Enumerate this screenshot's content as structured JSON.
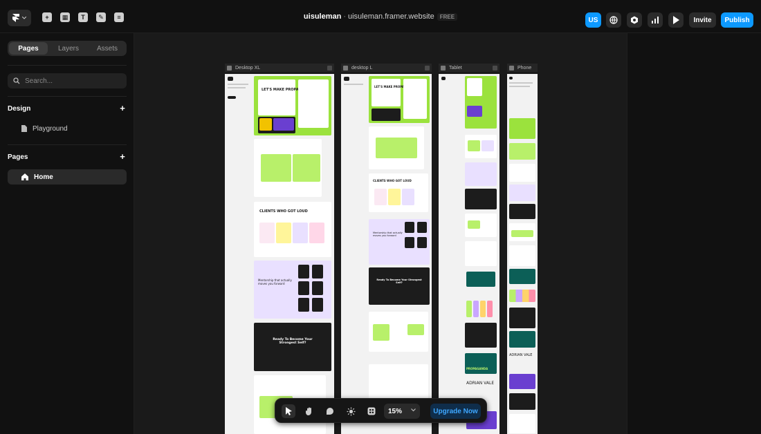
{
  "topbar": {
    "project_name": "uisuleman",
    "separator": "·",
    "domain": "uisuleman.framer.website",
    "plan_badge": "FREE",
    "user_initials": "US",
    "invite_label": "Invite",
    "publish_label": "Publish",
    "tool_icons": [
      "insert-icon",
      "layout-icon",
      "text-icon",
      "vector-icon",
      "cms-icon"
    ],
    "right_icons": [
      "globe-icon",
      "settings-icon",
      "analytics-icon",
      "preview-play-icon"
    ],
    "accent": "#0d99ff"
  },
  "sidebar": {
    "tabs": [
      {
        "label": "Pages",
        "active": true
      },
      {
        "label": "Layers",
        "active": false
      },
      {
        "label": "Assets",
        "active": false
      }
    ],
    "search_placeholder": "Search...",
    "design_section": {
      "title": "Design",
      "items": [
        {
          "label": "Playground",
          "icon": "file-icon"
        }
      ]
    },
    "pages_section": {
      "title": "Pages",
      "items": [
        {
          "label": "Home",
          "icon": "home-icon",
          "selected": true
        }
      ]
    }
  },
  "canvas": {
    "breakpoints": [
      {
        "label": "Desktop XL"
      },
      {
        "label": "desktop L"
      },
      {
        "label": "Tablet"
      },
      {
        "label": "Phone"
      }
    ],
    "preview_texts": {
      "hero": "LET'S MAKE PROPAGANDA",
      "clients": "CLIENTS WHO GOT LOUD",
      "mentorship": "Mentorship that actually moves you forward",
      "ready": "Ready To Become Your Strongest Self?",
      "name": "ADRIAN VALE",
      "brand": "PROPAGANDA"
    }
  },
  "bottom_toolbar": {
    "tools": [
      "select-arrow-icon",
      "hand-icon",
      "comment-icon",
      "theme-sun-icon",
      "components-icon"
    ],
    "zoom": "15%",
    "upgrade_label": "Upgrade Now"
  }
}
